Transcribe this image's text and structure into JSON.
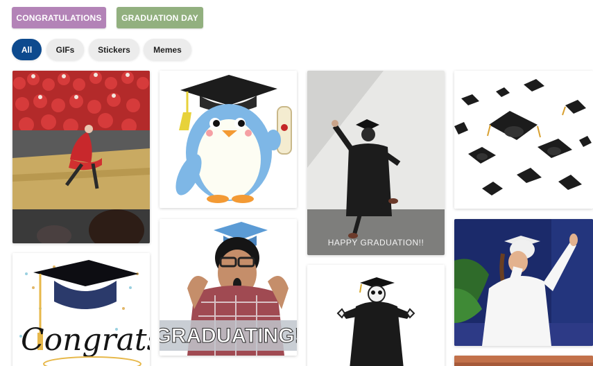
{
  "tags": [
    {
      "label": "CONGRATULATIONS",
      "color": "#b383b7"
    },
    {
      "label": "GRADUATION DAY",
      "color": "#92b07f"
    }
  ],
  "filters": [
    {
      "label": "All",
      "active": true
    },
    {
      "label": "GIFs",
      "active": false
    },
    {
      "label": "Stickers",
      "active": false
    },
    {
      "label": "Memes",
      "active": false
    }
  ],
  "colors": {
    "active_filter": "#0d4a8e",
    "inactive_filter": "#ececec"
  },
  "cards": [
    {
      "caption": ""
    },
    {
      "caption": ""
    },
    {
      "caption": "HAPPY GRADUATION!!"
    },
    {
      "caption": ""
    },
    {
      "caption": "Congrats!"
    },
    {
      "caption": "GRADUATING!"
    },
    {
      "caption": ""
    },
    {
      "caption": ""
    }
  ]
}
